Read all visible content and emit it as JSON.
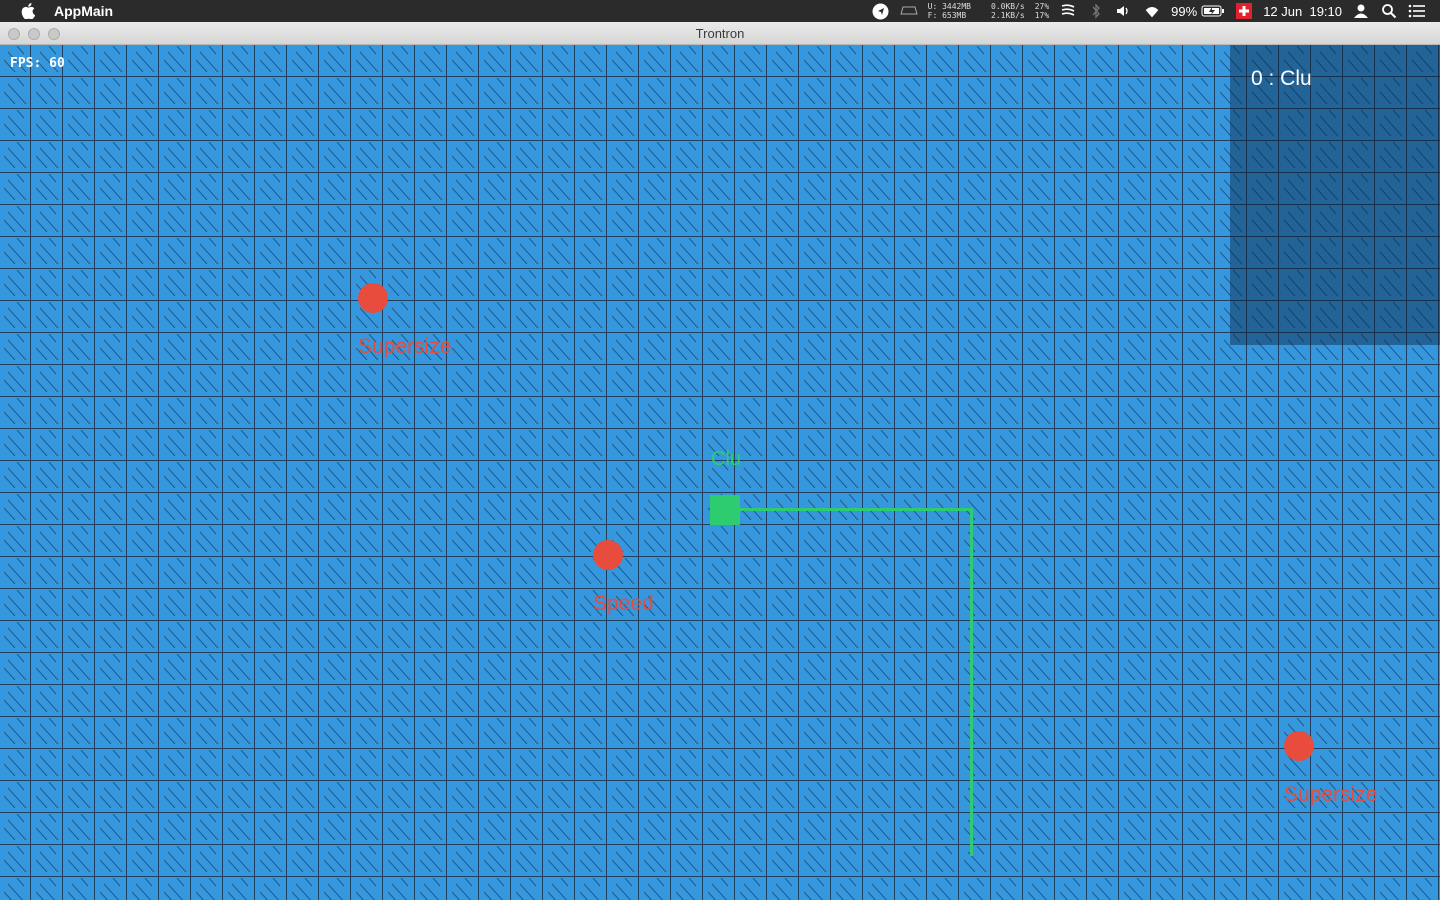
{
  "menubar": {
    "app_name": "AppMain",
    "memory": {
      "used": "U: 3442MB",
      "free": "F:  653MB"
    },
    "network": {
      "down": "0.0KB/s",
      "up": "2.1KB/s"
    },
    "cpu": {
      "top": "27%",
      "bottom": "17%"
    },
    "battery": "99%",
    "date_time": "12 Jun  19:10",
    "icons": [
      "apple-icon",
      "location-icon",
      "disk-icon",
      "stats-icon",
      "bluetooth-icon",
      "volume-icon",
      "wifi-icon",
      "battery-icon",
      "swiss-flag-icon",
      "user-icon",
      "spotlight-icon",
      "notification-center-icon"
    ]
  },
  "window": {
    "title": "Trontron"
  },
  "game": {
    "fps_text": "FPS: 60",
    "scoreboard": [
      {
        "text": "0 : Clu"
      }
    ],
    "colors": {
      "background": "#3597dd",
      "grid_line": "#1f4b6e",
      "player": "#2ecc71",
      "powerup": "#e74c3c"
    },
    "player": {
      "name": "Clu"
    },
    "powerups": [
      {
        "label": "Supersize"
      },
      {
        "label": "Speed"
      },
      {
        "label": "Supersize"
      }
    ]
  }
}
